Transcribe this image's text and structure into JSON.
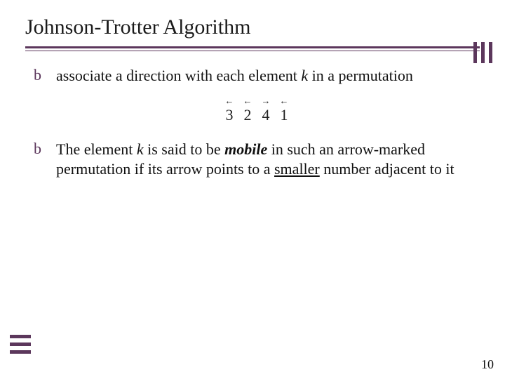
{
  "title": "Johnson-Trotter Algorithm",
  "bullets": {
    "b1": {
      "sym": "b",
      "pre": "associate a direction with each element ",
      "k": "k",
      "post": " in a permutation"
    },
    "b2": {
      "sym": "b",
      "pre": "The element ",
      "k": "k",
      "mid1": " is said to be ",
      "mobile": "mobile",
      "mid2": " in such an arrow-marked permutation if its arrow points to a ",
      "smaller": "smaller",
      "post": " number adjacent to it"
    }
  },
  "perm": {
    "d1": {
      "val": "3",
      "arrow": "←"
    },
    "d2": {
      "val": "2",
      "arrow": "←"
    },
    "d3": {
      "val": "4",
      "arrow": "→"
    },
    "d4": {
      "val": "1",
      "arrow": "←"
    }
  },
  "page_number": "10"
}
